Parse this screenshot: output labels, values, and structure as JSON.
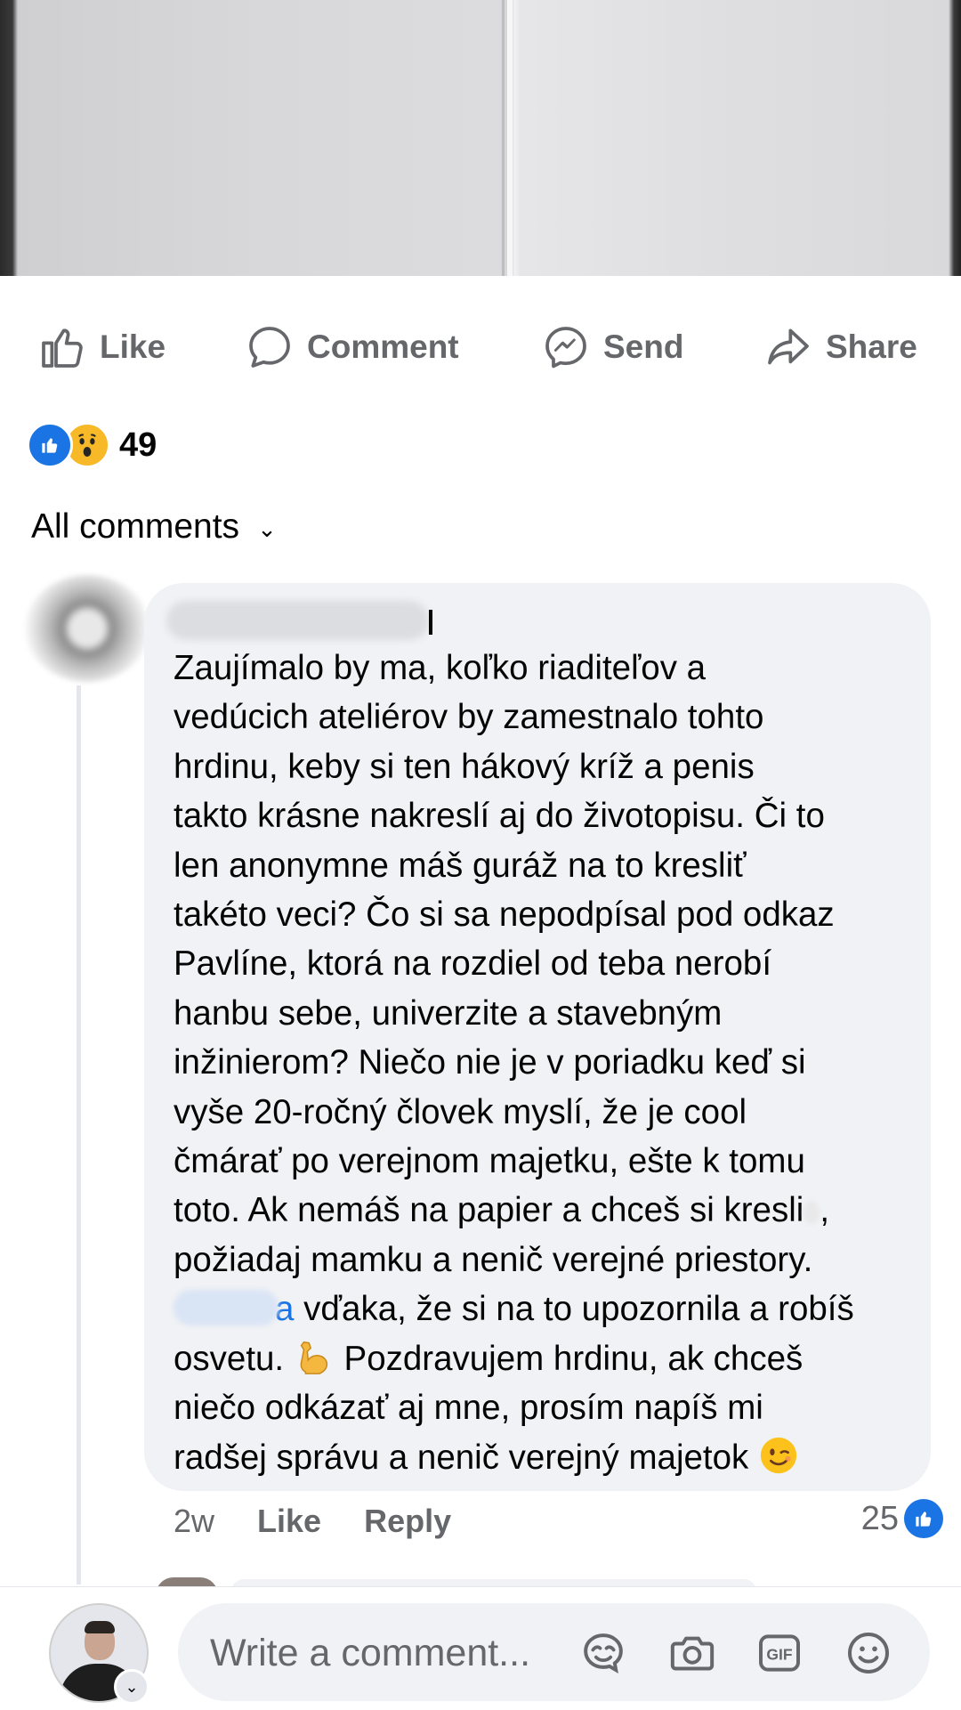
{
  "post": {
    "actions": [
      {
        "label": "Like",
        "icon": "thumbs-up-icon"
      },
      {
        "label": "Comment",
        "icon": "comment-bubble-icon"
      },
      {
        "label": "Send",
        "icon": "messenger-icon"
      },
      {
        "label": "Share",
        "icon": "share-arrow-icon"
      }
    ],
    "reaction_count": "49",
    "reaction_icons": [
      "like-reaction-icon",
      "wow-reaction-icon"
    ],
    "comments_filter": "All comments"
  },
  "comment": {
    "lines": [
      "Zaujímalo by ma, koľko riaditeľov a",
      "vedúcich ateliérov by zamestnalo tohto",
      "hrdinu, keby si ten hákový kríž a penis",
      "takto krásne nakreslí aj do životopisu. Či to",
      "len anonymne máš guráž na to kresliť",
      "takéto veci? Čo si sa nepodpísal pod odkaz",
      "Pavlíne, ktorá na rozdiel od teba nerobí",
      "hanbu sebe, univerzite a stavebným",
      "inžinierom? Niečo nie je v poriadku keď si",
      "vyše 20-ročný človek myslí, že je cool",
      "čmárať po verejnom majetku, ešte k tomu"
    ],
    "line12": "toto. Ak nemáš na papier a chceš si kresli",
    "line12_end": ",",
    "line13": "požiadaj mamku a nenič verejné priestory.",
    "mention_tail": "a",
    "line14": " vďaka, že si na to upozornila a robíš",
    "line15a": "osvetu. ",
    "line15b": " Pozdravujem hrdinu, ak chceš",
    "line16": "niečo odkázať aj mne, prosím napíš mi",
    "line17": "radšej správu a nenič verejný majetok ",
    "emojis": [
      "flexed-biceps-emoji",
      "winking-face-emoji"
    ],
    "time": "2w",
    "like_label": "Like",
    "reply_label": "Reply",
    "like_count": "25"
  },
  "composer": {
    "placeholder": "Write a comment...",
    "icons": [
      "avatar-sticker-icon",
      "camera-icon",
      "gif-icon",
      "emoji-icon"
    ]
  },
  "colors": {
    "accent": "#1b74e4",
    "secondary_text": "#65676b",
    "bubble": "#f0f2f5",
    "wow": "#f7b928"
  }
}
